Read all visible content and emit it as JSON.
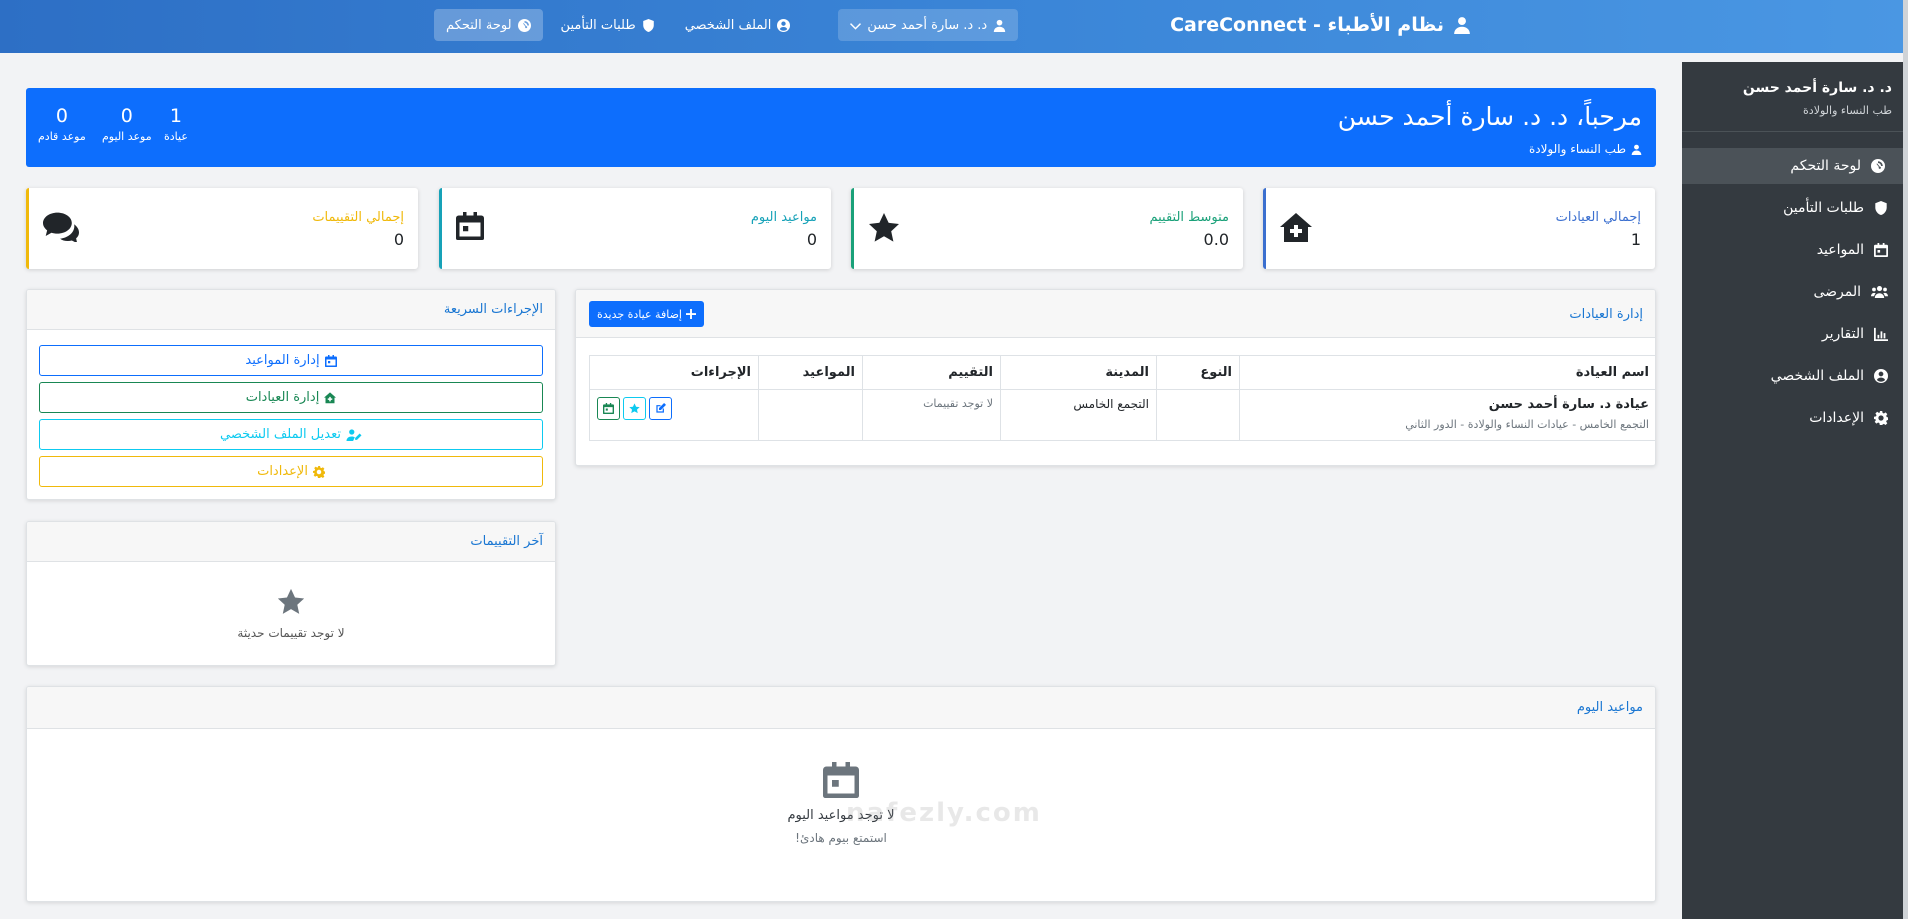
{
  "app": {
    "brand": "نظام الأطباء - CareConnect"
  },
  "navbar": {
    "items": [
      {
        "label": "لوحة التحكم",
        "icon": "gauge-icon",
        "active": true
      },
      {
        "label": "طلبات التأمين",
        "icon": "shield-icon",
        "active": false
      },
      {
        "label": "الملف الشخصي",
        "icon": "user-circle-icon",
        "active": false
      }
    ],
    "user_menu": "د. د. سارة أحمد حسن"
  },
  "sidebar": {
    "doctor_name": "د. د. سارة أحمد حسن",
    "specialty": "طب النساء والولادة",
    "items": [
      {
        "label": "لوحة التحكم",
        "icon": "gauge-icon",
        "active": true
      },
      {
        "label": "طلبات التأمين",
        "icon": "shield-icon",
        "active": false
      },
      {
        "label": "المواعيد",
        "icon": "calendar-icon",
        "active": false
      },
      {
        "label": "المرضى",
        "icon": "users-icon",
        "active": false
      },
      {
        "label": "التقارير",
        "icon": "chart-icon",
        "active": false
      },
      {
        "label": "الملف الشخصي",
        "icon": "user-circle-icon",
        "active": false
      },
      {
        "label": "الإعدادات",
        "icon": "gear-icon",
        "active": false
      }
    ]
  },
  "welcome": {
    "title": "مرحباً، د. د. سارة أحمد حسن",
    "specialty": "طب النساء والولادة",
    "stats": [
      {
        "value": "1",
        "label": "عيادة"
      },
      {
        "value": "0",
        "label": "موعد اليوم"
      },
      {
        "value": "0",
        "label": "موعد قادم"
      }
    ]
  },
  "stat_cards": [
    {
      "label": "إجمالي العيادات",
      "value": "1",
      "color": "#3b6fcf",
      "icon": "clinic-icon"
    },
    {
      "label": "متوسط التقييم",
      "value": "0.0",
      "color": "#1aa179",
      "icon": "star-icon"
    },
    {
      "label": "مواعيد اليوم",
      "value": "0",
      "color": "#17a2b8",
      "icon": "calendar-icon"
    },
    {
      "label": "إجمالي التقييمات",
      "value": "0",
      "color": "#f0b90b",
      "icon": "comments-icon"
    }
  ],
  "clinics_panel": {
    "title": "إدارة العيادات",
    "add_button": "إضافة عيادة جديدة",
    "columns": [
      "اسم العيادة",
      "النوع",
      "المدينة",
      "التقييم",
      "المواعيد",
      "الإجراءات"
    ],
    "rows": [
      {
        "name": "عيادة د. سارة أحمد حسن",
        "address": "التجمع الخامس - عيادات النساء والولادة - الدور الثاني",
        "type": "",
        "city": "التجمع الخامس",
        "rating": "لا توجد تقييمات",
        "appointments": ""
      }
    ]
  },
  "quick_actions": {
    "title": "الإجراءات السريعة",
    "buttons": [
      {
        "label": "إدارة المواعيد",
        "color": "#0d6efd",
        "icon": "calendar-icon"
      },
      {
        "label": "إدارة العيادات",
        "color": "#198754",
        "icon": "clinic-icon"
      },
      {
        "label": "تعديل الملف الشخصي",
        "color": "#0dcaf0",
        "icon": "user-edit-icon"
      },
      {
        "label": "الإعدادات",
        "color": "#f0b90b",
        "icon": "gear-icon"
      }
    ]
  },
  "latest_reviews": {
    "title": "آخر التقييمات",
    "empty_text": "لا توجد تقييمات حديثة"
  },
  "today_appointments": {
    "title": "مواعيد اليوم",
    "empty_title": "لا توجد مواعيد اليوم",
    "empty_sub": "استمتع بيوم هادئ!"
  },
  "watermark": "nafezly.com"
}
